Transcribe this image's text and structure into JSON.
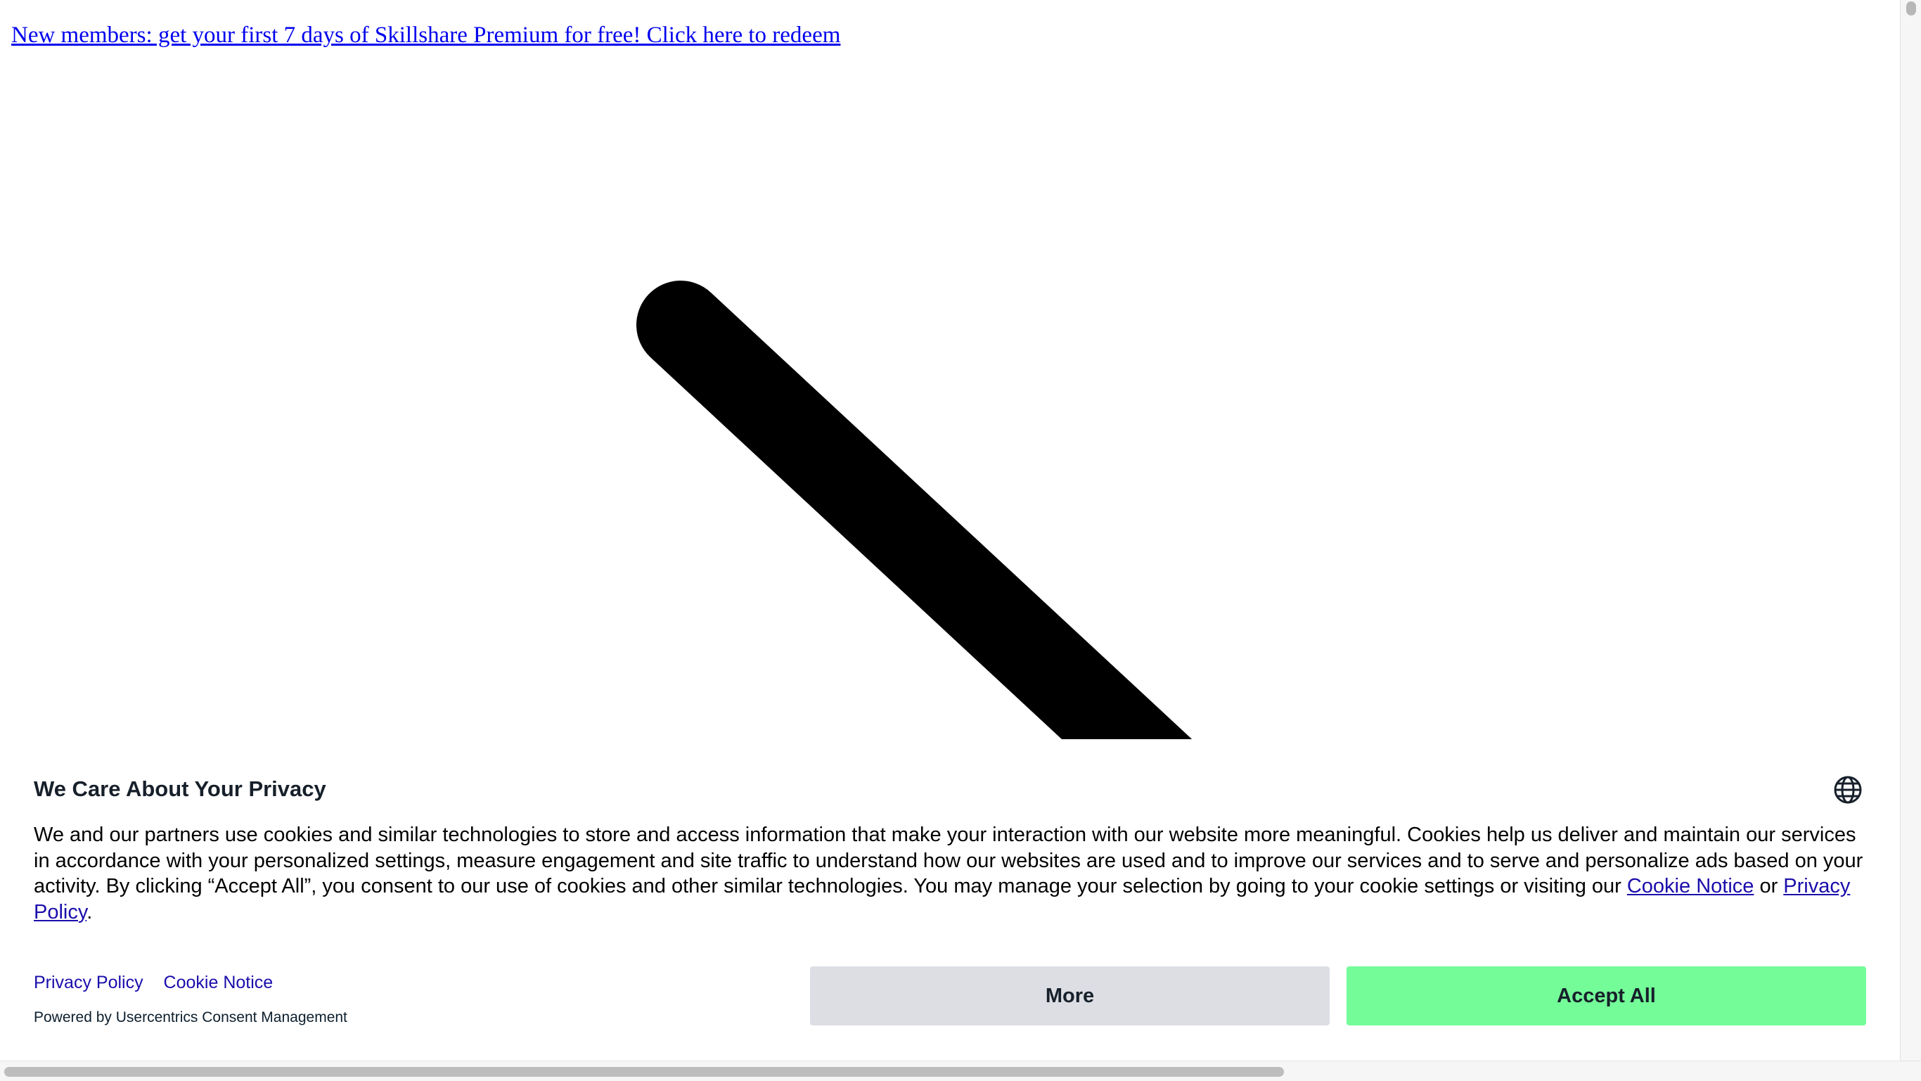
{
  "promo": {
    "link_text": "New members: get your first 7 days of Skillshare Premium for free! Click here to redeem"
  },
  "hero": {
    "icon": "diagonal-stroke-graphic",
    "color": "#000000"
  },
  "consent": {
    "title": "We Care About Your Privacy",
    "language_icon": "globe-icon",
    "body_text": "We and our partners use cookies and similar technologies to store and access information that make your interaction with our website more meaningful. Cookies help us deliver and maintain our services in accordance with your personalized settings, measure engagement and site traffic to understand how our websites are used and to improve our services and to serve and personalize ads based on your activity. By clicking “Accept All”, you consent to our use of cookies and other similar technologies. You may manage your selection by going to your cookie settings or visiting our ",
    "cookie_notice_inline": "Cookie Notice",
    "or_text": " or ",
    "privacy_policy_inline": "Privacy Policy",
    "period": ".",
    "footer_links": {
      "privacy_policy": "Privacy Policy",
      "cookie_notice": "Cookie Notice"
    },
    "powered_by": "Powered by Usercentrics Consent Management",
    "buttons": {
      "more": "More",
      "accept_all": "Accept All"
    }
  },
  "colors": {
    "accept_button": "#73fc98",
    "more_button": "#dcdee3",
    "link": "#1a0dab",
    "promo_link": "#0000ee"
  }
}
